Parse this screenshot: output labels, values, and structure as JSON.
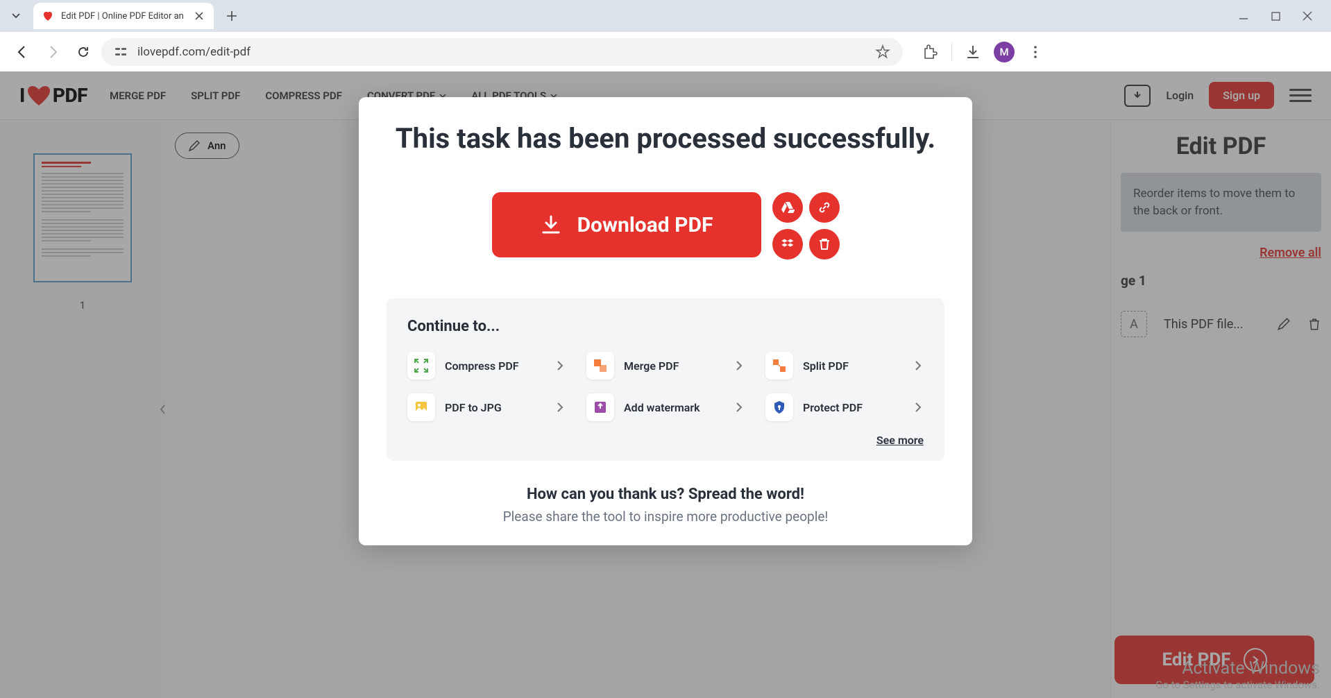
{
  "browser": {
    "tab_title": "Edit PDF | Online PDF Editor an",
    "url": "ilovepdf.com/edit-pdf",
    "avatar_letter": "M"
  },
  "header": {
    "logo_prefix": "I",
    "logo_suffix": "PDF",
    "nav": [
      "MERGE PDF",
      "SPLIT PDF",
      "COMPRESS PDF",
      "CONVERT PDF",
      "ALL PDF TOOLS"
    ],
    "login": "Login",
    "signup": "Sign up"
  },
  "editor": {
    "annotate_label": "Ann",
    "thumb_number": "1",
    "panel_title": "Edit PDF",
    "hint": "Reorder items to move them to the back or front.",
    "remove_all": "Remove all",
    "page_label": "ge 1",
    "item_text": "This PDF file...",
    "edit_button": "Edit PDF"
  },
  "modal": {
    "title": "This task has been processed successfully.",
    "download": "Download PDF",
    "continue_title": "Continue to...",
    "tools": [
      {
        "label": "Compress PDF",
        "color": "#4ea84e"
      },
      {
        "label": "Merge PDF",
        "color": "#f27d3f"
      },
      {
        "label": "Split PDF",
        "color": "#f27d3f"
      },
      {
        "label": "PDF to JPG",
        "color": "#f5c542"
      },
      {
        "label": "Add watermark",
        "color": "#9c4da8"
      },
      {
        "label": "Protect PDF",
        "color": "#2e5cb8"
      }
    ],
    "see_more": "See more",
    "thank_title": "How can you thank us? Spread the word!",
    "thank_sub": "Please share the tool to inspire more productive people!"
  },
  "watermark": {
    "line1": "Activate Windows",
    "line2": "Go to Settings to activate Windows."
  }
}
